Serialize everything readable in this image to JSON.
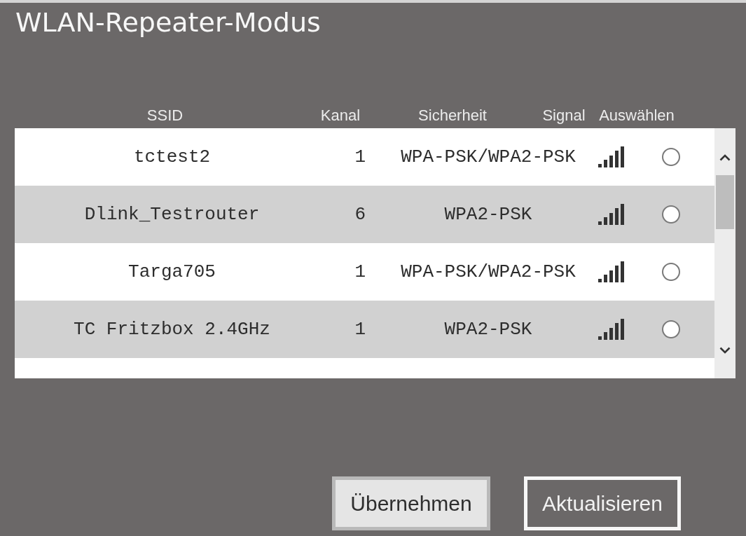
{
  "window": {
    "title": "WLAN-Repeater-Modus"
  },
  "table": {
    "columns": [
      "SSID",
      "Kanal",
      "Sicherheit",
      "Signal",
      "Auswählen"
    ],
    "rows": [
      {
        "ssid": "tctest2",
        "channel": "1",
        "security": "WPA-PSK/WPA2-PSK",
        "selected": false
      },
      {
        "ssid": "Dlink_Testrouter",
        "channel": "6",
        "security": "WPA2-PSK",
        "selected": false
      },
      {
        "ssid": "Targa705",
        "channel": "1",
        "security": "WPA-PSK/WPA2-PSK",
        "selected": false
      },
      {
        "ssid": "TC Fritzbox 2.4GHz",
        "channel": "1",
        "security": "WPA2-PSK",
        "selected": false
      }
    ]
  },
  "buttons": [
    {
      "label": "Übernehmen",
      "kind": "filled"
    },
    {
      "label": "Aktualisieren",
      "kind": "outlined"
    }
  ]
}
